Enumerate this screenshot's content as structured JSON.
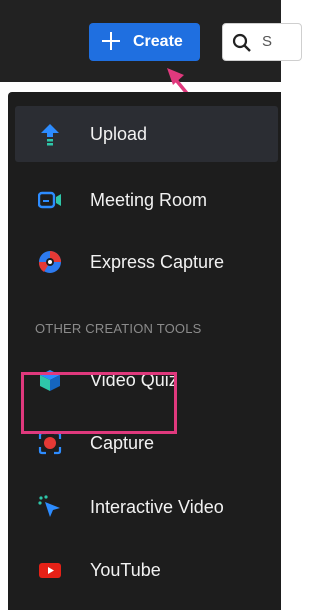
{
  "header": {
    "create_label": "Create",
    "search_text": "S"
  },
  "menu": {
    "items": [
      {
        "label": "Upload",
        "icon": "upload-icon"
      },
      {
        "label": "Meeting Room",
        "icon": "meeting-room-icon"
      },
      {
        "label": "Express Capture",
        "icon": "express-capture-icon"
      }
    ],
    "section_title": "OTHER CREATION TOOLS",
    "other_items": [
      {
        "label": "Video Quiz",
        "icon": "video-quiz-icon"
      },
      {
        "label": "Capture",
        "icon": "capture-icon"
      },
      {
        "label": "Interactive Video",
        "icon": "interactive-video-icon"
      },
      {
        "label": "YouTube",
        "icon": "youtube-icon"
      }
    ]
  },
  "colors": {
    "accent_blue": "#1f6fe0",
    "annotation_pink": "#e0397d",
    "menu_background": "#1d1d1d"
  }
}
